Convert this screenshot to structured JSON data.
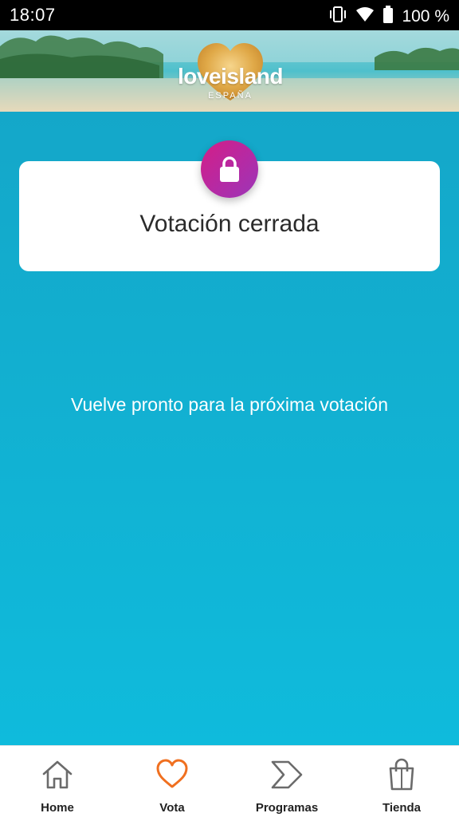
{
  "status_bar": {
    "time": "18:07",
    "battery_text": "100 %",
    "icons": [
      "vibrate-icon",
      "wifi-icon",
      "battery-icon"
    ]
  },
  "header": {
    "logo_text": "loveisland",
    "logo_subtext": "ESPAÑA"
  },
  "vote_card": {
    "title": "Votación cerrada",
    "icon": "lock-icon"
  },
  "message": "Vuelve pronto para la próxima votación",
  "bottom_nav": {
    "items": [
      {
        "label": "Home",
        "icon": "home-icon",
        "active": false
      },
      {
        "label": "Vota",
        "icon": "heart-icon",
        "active": true
      },
      {
        "label": "Programas",
        "icon": "play-arrow-icon",
        "active": false
      },
      {
        "label": "Tienda",
        "icon": "shopping-bag-icon",
        "active": false
      }
    ]
  },
  "colors": {
    "background_top": "#14a7c9",
    "background_bottom": "#0fbbdc",
    "badge_start": "#d41e86",
    "badge_end": "#9b36b8",
    "active_nav": "#f07020",
    "inactive_nav": "#6b6b6b"
  }
}
